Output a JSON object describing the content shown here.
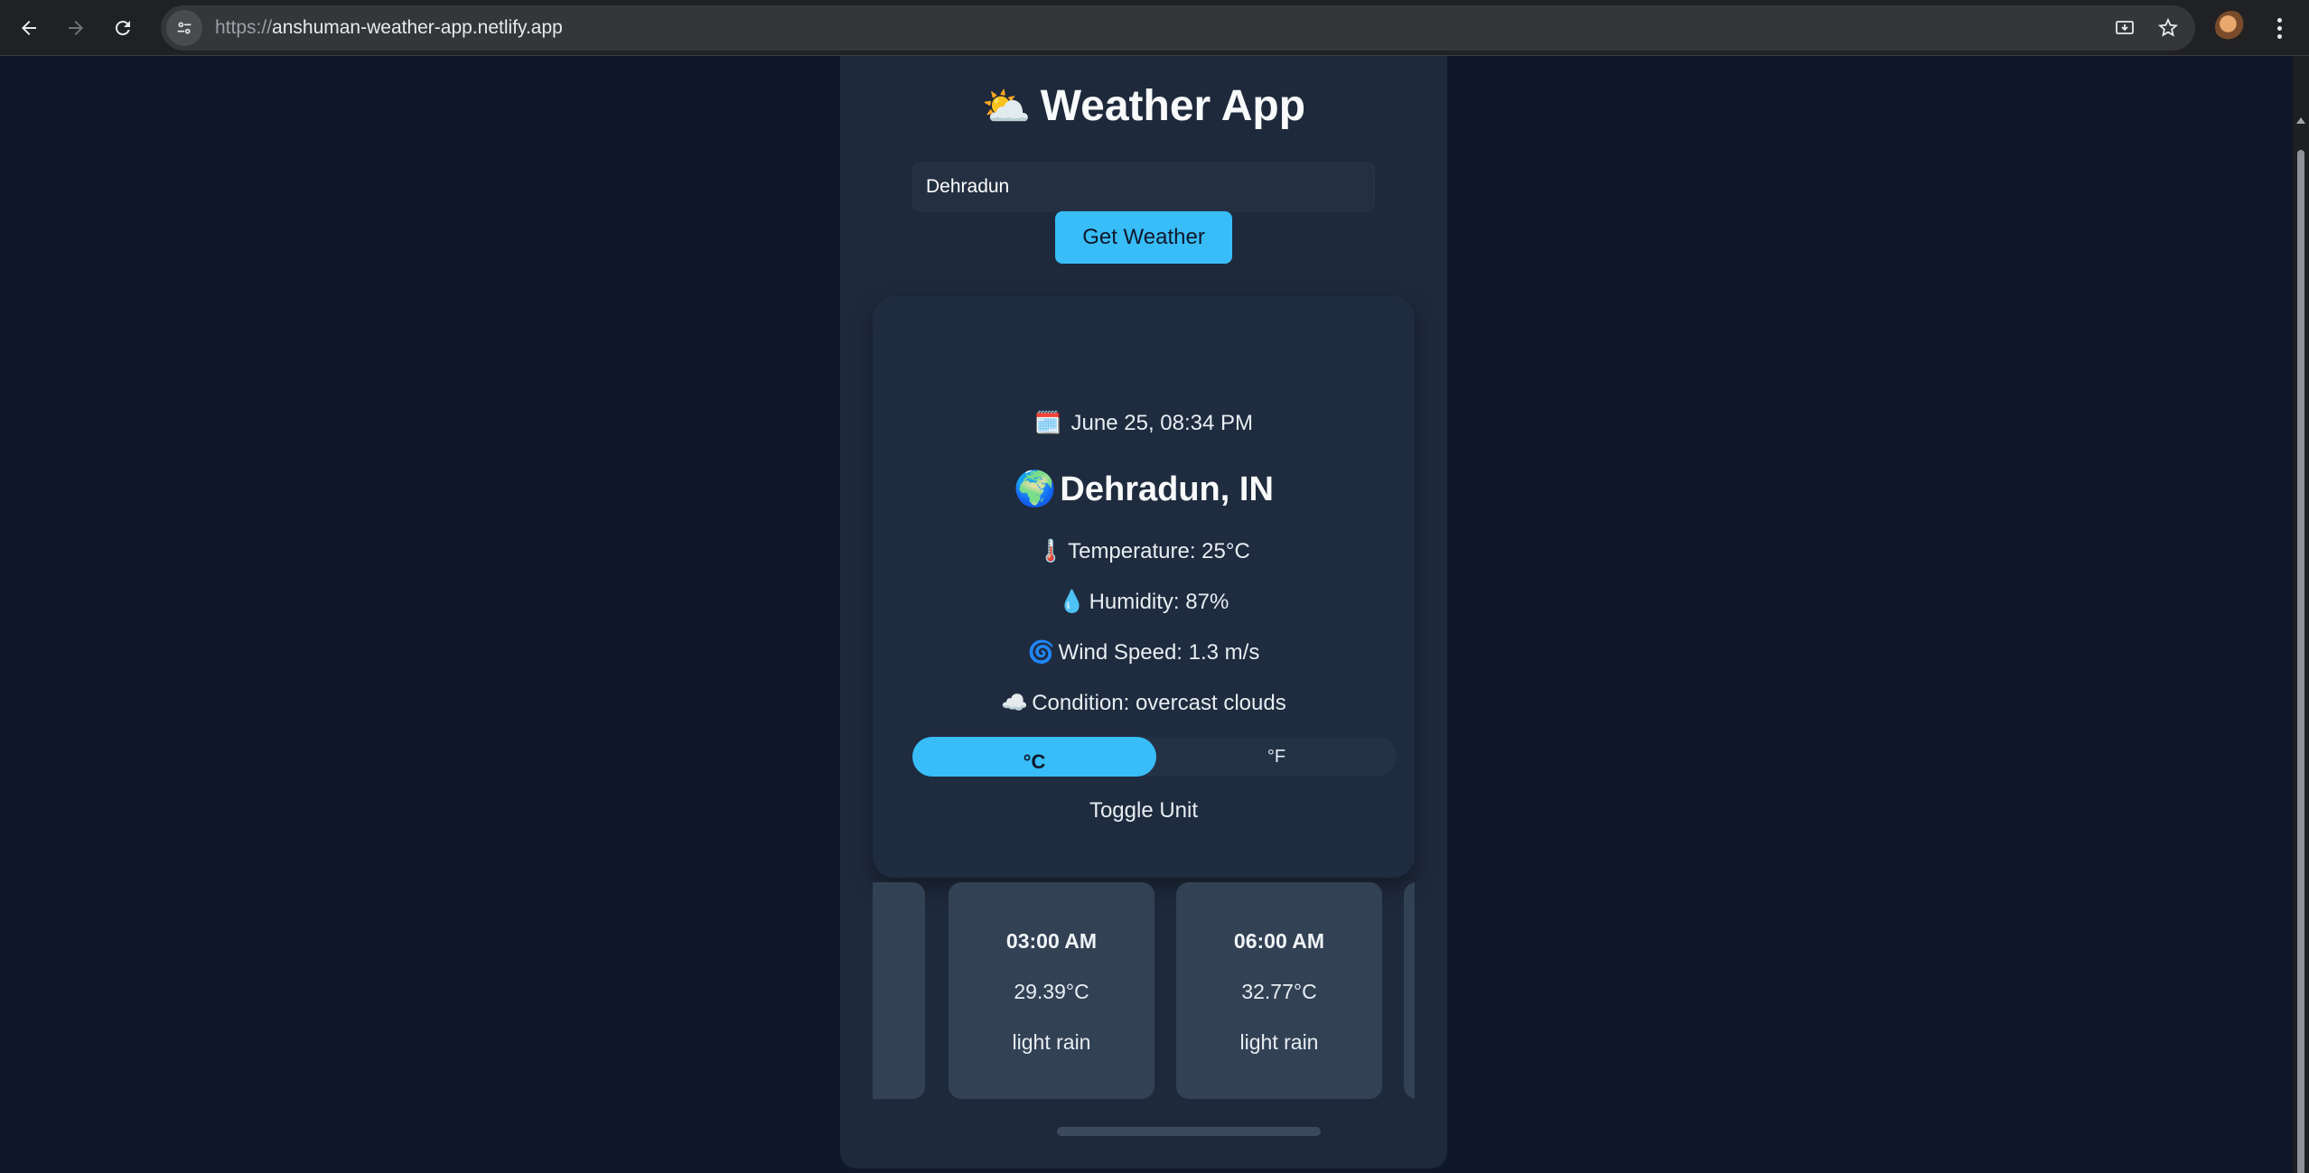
{
  "browser": {
    "url_protocol": "https://",
    "url_host": "anshuman-weather-app.netlify.app"
  },
  "app": {
    "title_emoji": "⛅",
    "title": "Weather App",
    "search": {
      "value": "Dehradun"
    },
    "get_button": "Get Weather"
  },
  "weather": {
    "date_icon": "🗓️",
    "date": "June 25, 08:34 PM",
    "city_icon": "🌍",
    "city": "Dehradun, IN",
    "temp_icon": "🌡️",
    "temperature": "Temperature: 25°C",
    "humidity_icon": "💧",
    "humidity": "Humidity: 87%",
    "wind_icon": "🌀",
    "wind": "Wind Speed: 1.3 m/s",
    "condition_icon": "☁️",
    "condition": "Condition: overcast clouds",
    "unit_celsius": "°C",
    "unit_fahrenheit": "°F",
    "unit_selected": "°C",
    "toggle_label": "Toggle Unit"
  },
  "forecast": [
    {
      "time": "03:00 AM",
      "temp": "29.39°C",
      "desc": "light rain"
    },
    {
      "time": "06:00 AM",
      "temp": "32.77°C",
      "desc": "light rain"
    }
  ],
  "colors": {
    "page_bg": "#0f172a",
    "panel_bg": "#1e293b",
    "accent": "#38bdf8",
    "forecast_card": "#334155"
  }
}
